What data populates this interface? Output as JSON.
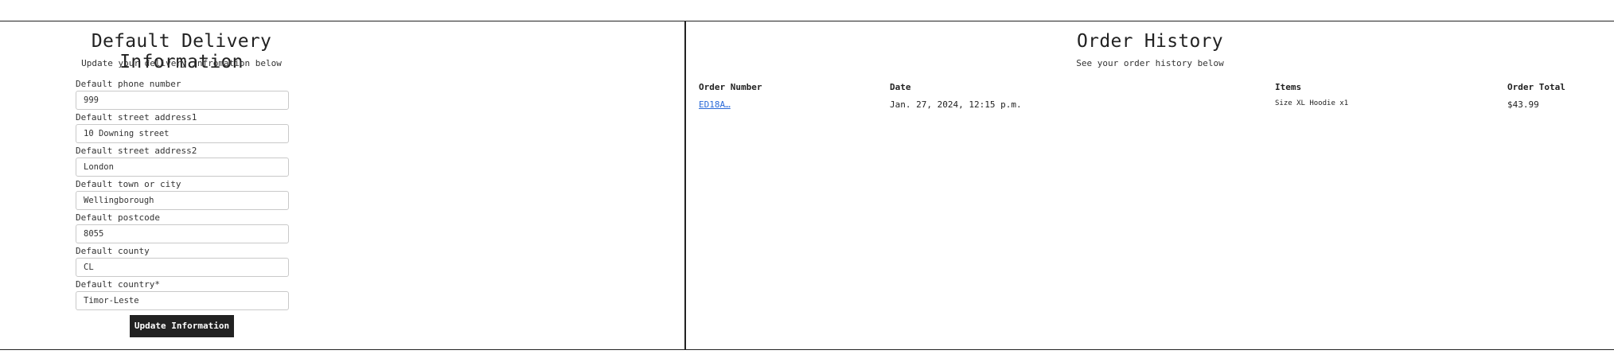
{
  "delivery": {
    "title": "Default Delivery Information",
    "subtitle": "Update your delivery infromation below",
    "fields": [
      {
        "label": "Default phone number",
        "value": "999"
      },
      {
        "label": "Default street address1",
        "value": "10 Downing street"
      },
      {
        "label": "Default street address2",
        "value": "London"
      },
      {
        "label": "Default town or city",
        "value": "Wellingborough"
      },
      {
        "label": "Default postcode",
        "value": "8055"
      },
      {
        "label": "Default county",
        "value": "CL"
      },
      {
        "label": "Default country*",
        "value": "Timor-Leste"
      }
    ],
    "submit_label": "Update Information"
  },
  "history": {
    "title": "Order History",
    "subtitle": "See your order history below",
    "columns": [
      "Order Number",
      "Date",
      "Items",
      "Order Total"
    ],
    "rows": [
      {
        "order_number": "ED18A…",
        "date": "Jan. 27, 2024, 12:15 p.m.",
        "items": "Size XL Hoodie x1",
        "total": "$43.99"
      }
    ]
  }
}
